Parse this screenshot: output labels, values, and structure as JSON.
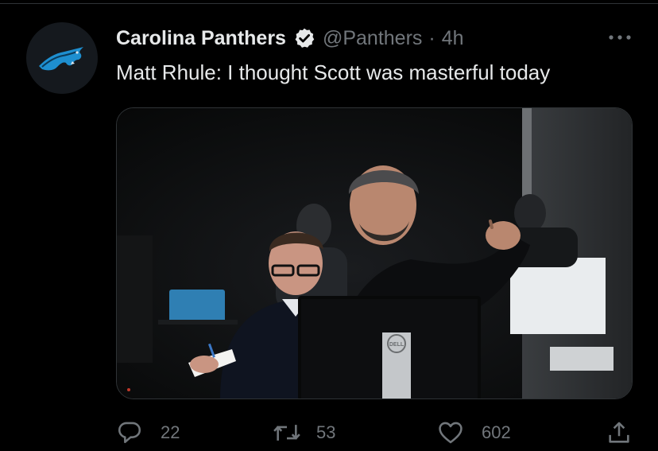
{
  "tweet": {
    "display_name": "Carolina Panthers",
    "verified": true,
    "handle": "@Panthers",
    "separator": "·",
    "time": "4h",
    "more_icon": "more-icon",
    "text": "Matt Rhule: I thought Scott was masterful today",
    "avatar_icon": "panther-logo",
    "media": {
      "alt_icon": "photo",
      "monitor_brand": "DELL"
    },
    "actions": {
      "reply_count": "22",
      "retweet_count": "53",
      "like_count": "602"
    }
  },
  "colors": {
    "background": "#000000",
    "text_primary": "#e7e9ea",
    "text_secondary": "#71767b",
    "panther_blue": "#1e8fd0"
  }
}
